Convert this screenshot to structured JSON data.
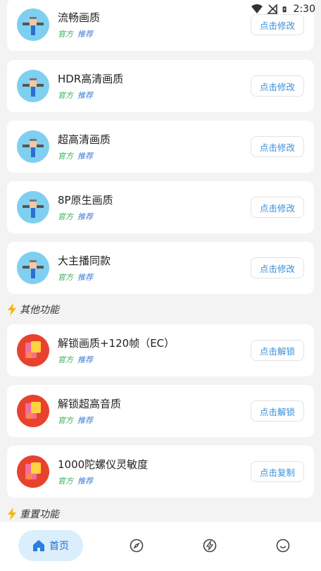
{
  "status_bar": {
    "time": "2:30",
    "wifi_icon": "wifi-icon",
    "signal_icon": "no-signal-icon",
    "battery_icon": "battery-charging-icon"
  },
  "cards": [
    {
      "title": "流畅画质",
      "tag1": "官方",
      "tag2": "推荐",
      "button": "点击修改",
      "icon": "tools-icon"
    },
    {
      "title": "HDR高清画质",
      "tag1": "官方",
      "tag2": "推荐",
      "button": "点击修改",
      "icon": "tools-icon"
    },
    {
      "title": "超高清画质",
      "tag1": "官方",
      "tag2": "推荐",
      "button": "点击修改",
      "icon": "tools-icon"
    },
    {
      "title": "8P原生画质",
      "tag1": "官方",
      "tag2": "推荐",
      "button": "点击修改",
      "icon": "tools-icon"
    },
    {
      "title": "大主播同款",
      "tag1": "官方",
      "tag2": "推荐",
      "button": "点击修改",
      "icon": "tools-icon"
    },
    {
      "title": "解锁画质+120帧（EC）",
      "tag1": "官方",
      "tag2": "推荐",
      "button": "点击解锁",
      "icon": "puzzle-icon"
    },
    {
      "title": "解锁超高音质",
      "tag1": "官方",
      "tag2": "推荐",
      "button": "点击解锁",
      "icon": "puzzle-icon"
    },
    {
      "title": "1000陀螺仪灵敏度",
      "tag1": "官方",
      "tag2": "推荐",
      "button": "点击复制",
      "icon": "puzzle-icon"
    }
  ],
  "sections": {
    "other": "其他功能",
    "reset": "重置功能"
  },
  "bottom_nav": {
    "home_label": "首页",
    "items": [
      "home-icon",
      "compass-icon",
      "bolt-icon",
      "smile-icon"
    ]
  },
  "colors": {
    "accent": "#3a8fd8",
    "official": "#3bb15b",
    "recommend": "#3a7bd5",
    "bolt": "#f5b800"
  }
}
